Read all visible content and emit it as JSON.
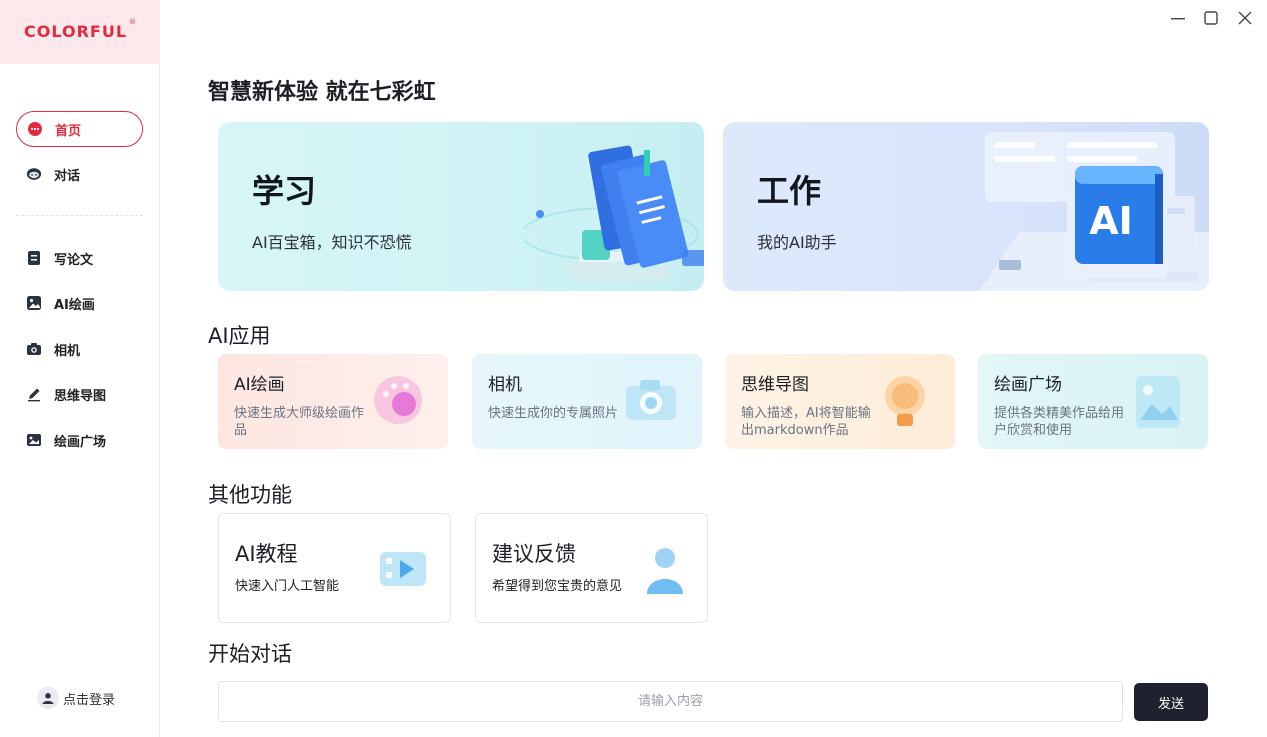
{
  "brand": {
    "logo_text": "COLORFUL",
    "logo_mark": "®",
    "accent": "#e5293f"
  },
  "window_controls": [
    {
      "name": "minimize-icon",
      "glyph": "—"
    },
    {
      "name": "maximize-icon",
      "glyph": "☐"
    },
    {
      "name": "close-icon",
      "glyph": "✕"
    }
  ],
  "sidebar": {
    "items": [
      {
        "label": "首页",
        "icon": "chat-bubble-icon",
        "active": true
      },
      {
        "label": "对话",
        "icon": "robot-icon",
        "active": false
      },
      {
        "label": "写论文",
        "icon": "document-icon",
        "active": false
      },
      {
        "label": "AI绘画",
        "icon": "image-icon",
        "active": false
      },
      {
        "label": "相机",
        "icon": "camera-icon",
        "active": false
      },
      {
        "label": "思维导图",
        "icon": "pen-icon",
        "active": false
      },
      {
        "label": "绘画广场",
        "icon": "gallery-icon",
        "active": false
      }
    ],
    "login_label": "点击登录"
  },
  "main": {
    "heading": "智慧新体验 就在七彩虹",
    "hero": [
      {
        "title": "学习",
        "subtitle": "AI百宝箱，知识不恐慌",
        "art": "books-icon"
      },
      {
        "title": "工作",
        "subtitle": "我的AI助手",
        "art": "ai-cube-icon",
        "art_text": "AI"
      }
    ],
    "ai_apps": {
      "title": "AI应用",
      "cards": [
        {
          "title": "AI绘画",
          "desc": "快速生成大师级绘画作品",
          "icon": "palette-icon"
        },
        {
          "title": "相机",
          "desc": "快速生成你的专属照片",
          "icon": "camera-icon"
        },
        {
          "title": "思维导图",
          "desc": "输入描述，AI将智能输出markdown作品",
          "icon": "lightbulb-icon"
        },
        {
          "title": "绘画广场",
          "desc": "提供各类精美作品给用户欣赏和使用",
          "icon": "picture-icon"
        }
      ]
    },
    "other": {
      "title": "其他功能",
      "cards": [
        {
          "title": "AI教程",
          "desc": "快速入门人工智能",
          "icon": "video-icon"
        },
        {
          "title": "建议反馈",
          "desc": "希望得到您宝贵的意见",
          "icon": "user-icon"
        }
      ]
    },
    "chat": {
      "title": "开始对话",
      "placeholder": "请输入内容",
      "send_label": "发送"
    }
  }
}
